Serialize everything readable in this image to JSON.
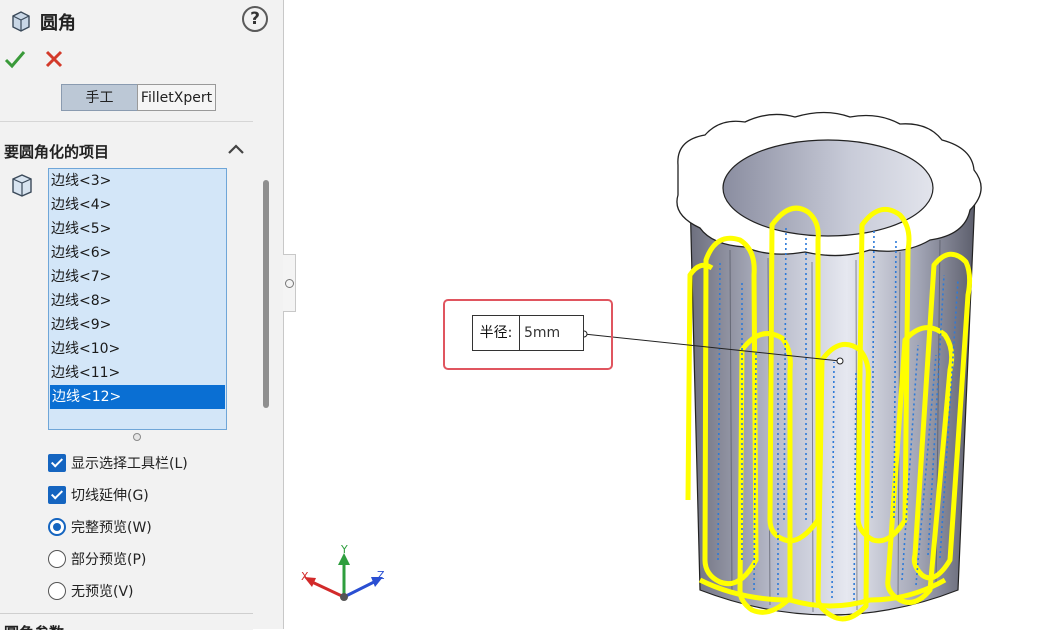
{
  "panel": {
    "title": "圆角",
    "help_symbol": "?",
    "tabs": {
      "manual": "手工",
      "expert": "FilletXpert"
    },
    "items_section": {
      "title": "要圆角化的项目",
      "edges": [
        "边线<3>",
        "边线<4>",
        "边线<5>",
        "边线<6>",
        "边线<7>",
        "边线<8>",
        "边线<9>",
        "边线<10>",
        "边线<11>",
        "边线<12>"
      ],
      "selected_edge": "边线<12>"
    },
    "options": {
      "show_selection_toolbar": {
        "label": "显示选择工具栏(L)",
        "checked": true
      },
      "tangent_propagation": {
        "label": "切线延伸(G)",
        "checked": true
      },
      "full_preview": {
        "label": "完整预览(W)",
        "selected": true
      },
      "partial_preview": {
        "label": "部分预览(P)",
        "selected": false
      },
      "no_preview": {
        "label": "无预览(V)",
        "selected": false
      }
    },
    "next_section_title": "圆角参数"
  },
  "viewport": {
    "radius_label": "半径:",
    "radius_value": "5mm",
    "triad": {
      "x": "X",
      "y": "Y",
      "z": "Z"
    }
  },
  "colors": {
    "highlight": "#ffff00",
    "accent": "#0a6fd3",
    "callout_border": "#e0555f",
    "ok_green": "#3a9a3a",
    "cancel_red": "#d33a2a"
  }
}
